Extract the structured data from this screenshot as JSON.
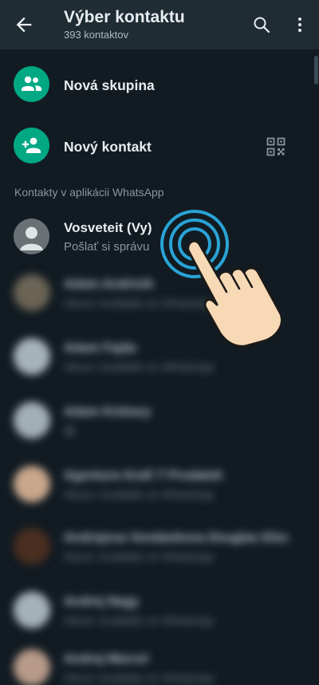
{
  "header": {
    "title": "Výber kontaktu",
    "subtitle": "393 kontaktov",
    "back_icon": "arrow-left-icon",
    "search_icon": "search-icon",
    "more_icon": "more-vertical-icon"
  },
  "actions": {
    "new_group": "Nová skupina",
    "new_contact": "Nový kontakt",
    "qr_icon": "qr-code-icon"
  },
  "section_header": "Kontakty v aplikácii WhatsApp",
  "self_contact": {
    "name": "Vosveteit (Vy)",
    "status": "Pošlať si správu"
  },
  "blurred_contacts": [
    {
      "name": "Adam Andrisik",
      "status": "About: Available on WhatsApp"
    },
    {
      "name": "Adam Fajda",
      "status": "About: Available on WhatsApp"
    },
    {
      "name": "Adam Kiskavy",
      "status": "😀"
    },
    {
      "name": "Agentura Grafi T Prodatek",
      "status": "About: Available on WhatsApp"
    },
    {
      "name": "Andrejova Vondankova Douglas Eles",
      "status": "About: Available on WhatsApp"
    },
    {
      "name": "Andrej Nagy",
      "status": "About: Available on WhatsApp"
    },
    {
      "name": "Andrej Marcel",
      "status": "About: Available on WhatsApp"
    }
  ],
  "colors": {
    "background": "#121b22",
    "appbar": "#1f2c34",
    "accent": "#00a884",
    "tap_ring": "#29a3d6"
  },
  "overlay": {
    "hand_icon": "tap-hand-icon"
  }
}
